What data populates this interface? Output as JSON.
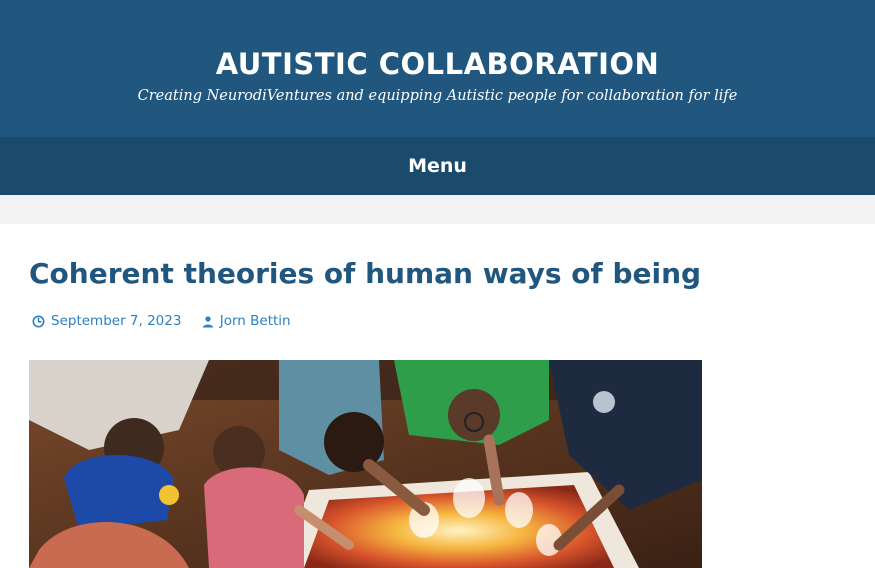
{
  "header": {
    "site_title": "AUTISTIC COLLABORATION",
    "site_description": "Creating NeurodiVentures and equipping Autistic people for collaboration for life",
    "background_color": "#21577f"
  },
  "nav": {
    "menu_label": "Menu",
    "background_color": "#1a4a6c"
  },
  "post": {
    "title": "Coherent theories of human ways of being",
    "date": "September 7, 2023",
    "author": "Jorn Bettin",
    "date_icon": "clock-icon",
    "author_icon": "person-icon",
    "title_color": "#21577f",
    "meta_color": "#2a82c0"
  }
}
